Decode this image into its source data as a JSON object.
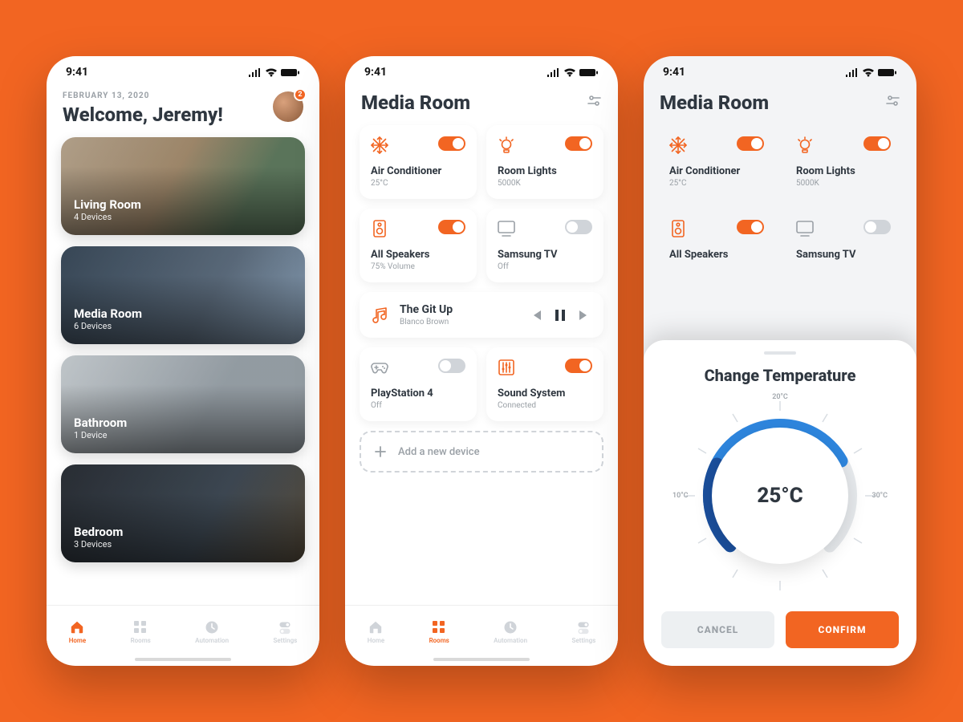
{
  "statusbar": {
    "time": "9:41"
  },
  "screen1": {
    "date": "FEBRUARY 13, 2020",
    "welcome": "Welcome, Jeremy!",
    "notification_count": "2",
    "rooms": [
      {
        "name": "Living Room",
        "sub": "4 Devices"
      },
      {
        "name": "Media Room",
        "sub": "6 Devices"
      },
      {
        "name": "Bathroom",
        "sub": "1 Device"
      },
      {
        "name": "Bedroom",
        "sub": "3 Devices"
      }
    ]
  },
  "screen2": {
    "title": "Media Room",
    "devices": [
      {
        "name": "Air Conditioner",
        "sub": "25°C",
        "on": true,
        "icon": "snowflake"
      },
      {
        "name": "Room Lights",
        "sub": "5000K",
        "on": true,
        "icon": "bulb"
      },
      {
        "name": "All Speakers",
        "sub": "75% Volume",
        "on": true,
        "icon": "speaker"
      },
      {
        "name": "Samsung TV",
        "sub": "Off",
        "on": false,
        "icon": "tv"
      },
      {
        "name": "PlayStation 4",
        "sub": "Off",
        "on": false,
        "icon": "gamepad"
      },
      {
        "name": "Sound System",
        "sub": "Connected",
        "on": true,
        "icon": "equalizer"
      }
    ],
    "now_playing": {
      "title": "The Git Up",
      "artist": "Blanco Brown"
    },
    "add_label": "Add a new device"
  },
  "screen3": {
    "title": "Media Room",
    "sheet": {
      "title": "Change Temperature",
      "value": "25°C",
      "ticks": {
        "top": "20°C",
        "left": "10°C",
        "right": "30°C"
      },
      "cancel": "CANCEL",
      "confirm": "CONFIRM"
    }
  },
  "tabs": [
    {
      "label": "Home",
      "icon": "home"
    },
    {
      "label": "Rooms",
      "icon": "grid"
    },
    {
      "label": "Automation",
      "icon": "clock"
    },
    {
      "label": "Settings",
      "icon": "sliders"
    }
  ],
  "colors": {
    "accent": "#F26522",
    "blue": "#2E86DE",
    "blue_dark": "#1B4F9C",
    "grey": "#9AA0A6"
  }
}
